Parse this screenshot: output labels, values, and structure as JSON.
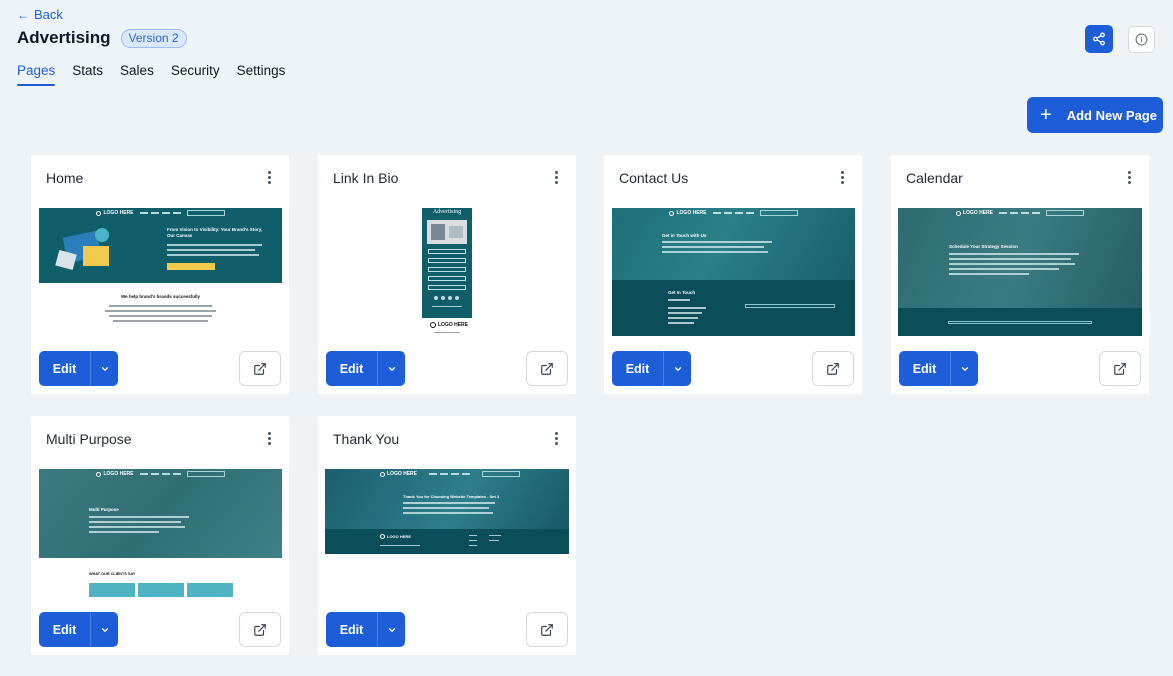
{
  "header": {
    "back_label": "Back",
    "title": "Advertising",
    "version_badge": "Version 2"
  },
  "tabs": [
    {
      "label": "Pages",
      "active": true
    },
    {
      "label": "Stats",
      "active": false
    },
    {
      "label": "Sales",
      "active": false
    },
    {
      "label": "Security",
      "active": false
    },
    {
      "label": "Settings",
      "active": false
    }
  ],
  "toolbar": {
    "add_page_label": "Add New Page"
  },
  "cards": [
    {
      "title": "Home",
      "edit_label": "Edit",
      "thumb_logo": "LOGO HERE",
      "thumb_heading": "From Vision to Visibility: Your Brand's Story, Our Canvas",
      "thumb_subheading": "We help brand's brands successfully"
    },
    {
      "title": "Link In Bio",
      "edit_label": "Edit",
      "thumb_heading": "Advertising",
      "thumb_logo": "LOGO HERE"
    },
    {
      "title": "Contact Us",
      "edit_label": "Edit",
      "thumb_logo": "LOGO HERE",
      "thumb_heading": "Get in Touch with Us",
      "thumb_subheading": "Get In Touch"
    },
    {
      "title": "Calendar",
      "edit_label": "Edit",
      "thumb_logo": "LOGO HERE",
      "thumb_heading": "Schedule Your Strategy Session"
    },
    {
      "title": "Multi Purpose",
      "edit_label": "Edit",
      "thumb_logo": "LOGO HERE",
      "thumb_heading": "Multi Purpose",
      "thumb_subheading": "WHAT OUR CLIENTS SAY"
    },
    {
      "title": "Thank You",
      "edit_label": "Edit",
      "thumb_logo": "LOGO HERE",
      "thumb_heading": "Thank You for Choosing Website Templates - Set 3"
    }
  ],
  "colors": {
    "accent": "#1d5ed8",
    "page_bg": "#eef3f8",
    "thumb_teal": "#0f5e6a"
  },
  "icons": {
    "back": "arrow-left-icon",
    "share": "share-icon",
    "info": "info-icon",
    "add": "plus-icon",
    "menu": "kebab-menu-icon",
    "caret": "chevron-down-icon",
    "open": "external-link-icon"
  }
}
